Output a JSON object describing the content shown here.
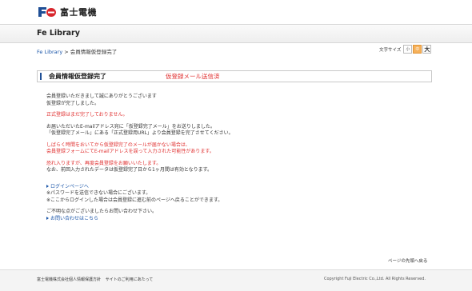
{
  "header": {
    "logo_text": "富士電機"
  },
  "site": {
    "title": "Fe Library"
  },
  "breadcrumb": {
    "home": "Fe Library",
    "separator": ">",
    "current": "会員情報仮登録完了"
  },
  "fontsize": {
    "label": "文字サイズ",
    "small": "小",
    "medium": "中",
    "large": "大"
  },
  "heading": {
    "title": "会員情報仮登録完了",
    "sub": "仮登録メール送信済"
  },
  "body": {
    "line1": "会員登録いただきまして誠にありがとうございます",
    "line2": "仮登録が完了しました。",
    "line3": "正式登録はまだ完了しておりません。",
    "line4": "お届いただいたE-mailアドレス宛に「仮登録完了メール」をお送りしました。",
    "line5": "「仮登録完了メール」にある「正式登録用URL」より会員登録を完了させてください。",
    "line6": "しばらく時間をおいてから仮登録完了のメールが届かない場合は、",
    "line7": "会員登録フォームにてE-mailアドレスを誤って入力された可能性があります。",
    "line8": "恐れ入りますが、再度会員登録をお願いいたします。",
    "line9": "なお、前回入力されたデータは仮登録完了日から1ヶ月間は有効となります。",
    "login_link": "ログインページへ",
    "line10": "※パスワードを送信できない場合にございます。",
    "line11": "※ここからログインした場合は会員登録に進む前のページへ戻ることができます。",
    "line12": "ご不明な点がございましたらお問い合わせ下さい。",
    "contact_link": "お問い合わせはこちら"
  },
  "print_link": "ページの先頭へ戻る",
  "footer": {
    "link1": "富士電機株式会社個人情報保護方針",
    "link2": "サイトのご利用にあたって",
    "copyright": "Copyright Fuji Electric Co.,Ltd. All Rights Reserved."
  },
  "colors": {
    "accent": "#1f4f96",
    "alert": "#e03030",
    "link": "#1a55a8"
  }
}
